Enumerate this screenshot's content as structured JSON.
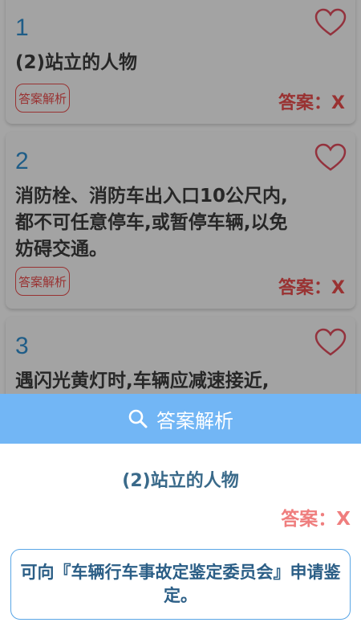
{
  "list": {
    "items": [
      {
        "number": "1",
        "question": "(2)站立的人物",
        "analysis_label": "答案解析",
        "answer": "答案：X"
      },
      {
        "number": "2",
        "question": "消防栓、消防车出入口10公尺内,都不可任意停车,或暂停车辆,以免妨碍交通。",
        "analysis_label": "答案解析",
        "answer": "答案：X"
      },
      {
        "number": "3",
        "question": "遇闪光黄灯时,车辆应减速接近,"
      }
    ]
  },
  "sheet": {
    "title": "答案解析",
    "title_icon": "search-icon",
    "question": "(2)站立的人物",
    "answer": "答案：X",
    "explanation": "可向『车辆行车事故定鉴定委员会』申请鉴定。"
  },
  "colors": {
    "accent_blue": "#72b6f5",
    "answer_red": "#e24b4b",
    "number_blue": "#2f89c8"
  }
}
